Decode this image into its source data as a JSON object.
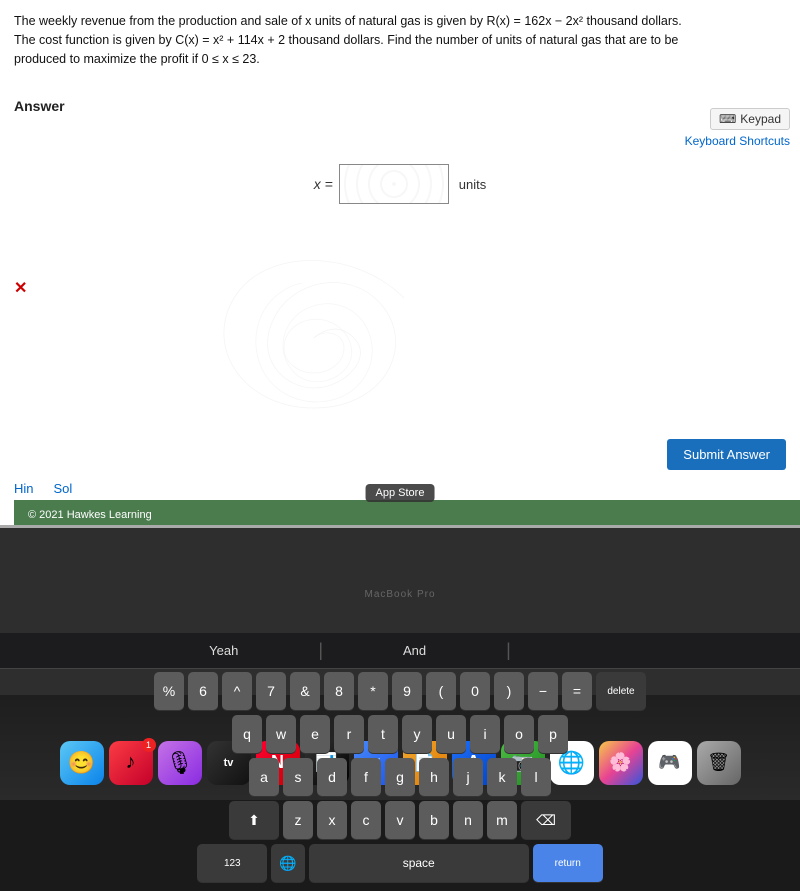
{
  "question": {
    "line1": "The weekly revenue from the production and sale of x units of natural gas is given by R(x) = 162x − 2x² thousand dollars.",
    "line2": "The cost function is given by C(x) = x² + 114x + 2 thousand dollars. Find the number of units of natural gas that are to be",
    "line3": "produced to maximize the profit if 0 ≤ x ≤ 23."
  },
  "answer": {
    "label": "Answer",
    "equation_prefix": "x =",
    "units_suffix": "units",
    "input_value": ""
  },
  "ui": {
    "keypad_label": "Keypad",
    "keyboard_shortcuts_label": "Keyboard Shortcuts",
    "submit_label": "Submit Answer",
    "hint_label": "Hin",
    "solution_label": "Sol"
  },
  "footer": {
    "copyright": "© 2021 Hawkes Learning",
    "app_store_tooltip": "App Store"
  },
  "dock": {
    "icons": [
      {
        "name": "finder",
        "label": "Finder",
        "emoji": "🔵",
        "class": "finder"
      },
      {
        "name": "music",
        "label": "Music",
        "emoji": "🎵",
        "class": "music"
      },
      {
        "name": "podcast",
        "label": "Podcasts",
        "emoji": "🎙",
        "class": "podcast"
      },
      {
        "name": "appletv",
        "label": "Apple TV",
        "emoji": "tv",
        "class": "appletv"
      },
      {
        "name": "news",
        "label": "News",
        "emoji": "📰",
        "class": "news"
      },
      {
        "name": "stocks",
        "label": "Stocks",
        "emoji": "📈",
        "class": "stocks"
      },
      {
        "name": "keynote",
        "label": "Keynote",
        "emoji": "K",
        "class": "keynote"
      },
      {
        "name": "pages",
        "label": "Pages",
        "emoji": "P",
        "class": "pages"
      },
      {
        "name": "appstore",
        "label": "App Store",
        "emoji": "A",
        "class": "appstore",
        "badge": ""
      },
      {
        "name": "facetime",
        "label": "FaceTime",
        "emoji": "📷",
        "class": "facetime"
      },
      {
        "name": "chrome",
        "label": "Chrome",
        "emoji": "🌐",
        "class": "chrome"
      },
      {
        "name": "photos",
        "label": "Photos",
        "emoji": "🌸",
        "class": "photos"
      },
      {
        "name": "roblox",
        "label": "Roblox",
        "emoji": "🎮",
        "class": "roblox"
      },
      {
        "name": "trash",
        "label": "Trash",
        "emoji": "🗑",
        "class": "trash"
      }
    ]
  },
  "keyboard": {
    "suggestions": [
      "Yeah",
      "And",
      ""
    ],
    "rows": [
      [
        "%",
        "6",
        "^",
        "7",
        "&",
        "8",
        "*",
        "9",
        "(",
        "0",
        ")",
        "−",
        "=",
        "delete"
      ],
      [
        "q",
        "w",
        "e",
        "r",
        "t",
        "y",
        "u",
        "i",
        "o",
        "p"
      ],
      [
        "a",
        "s",
        "d",
        "f",
        "g",
        "h",
        "j",
        "k",
        "l"
      ],
      [
        "⬆",
        "z",
        "x",
        "c",
        "v",
        "b",
        "n",
        "m",
        "⌫"
      ],
      [
        "123",
        "🌐",
        "space",
        "return"
      ]
    ]
  },
  "macos_title": "MacBook Pro"
}
